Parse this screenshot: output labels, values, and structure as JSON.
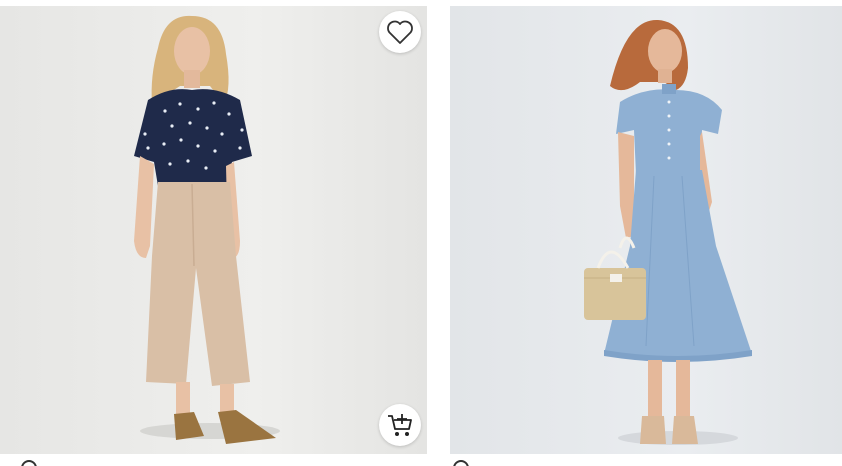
{
  "products": [
    {
      "image_alt": "",
      "favorite_icon": "heart-outline-icon",
      "cart_icon": "add-to-cart-icon",
      "colors": {
        "top": "#1f2a4a",
        "pants": "#d9bfa6",
        "shoes": "#9a7440",
        "hair": "#d8b47c",
        "skin": "#e8c1a5"
      }
    },
    {
      "image_alt": "",
      "colors": {
        "dress": "#8fb0d3",
        "hair": "#b86a3c",
        "bag": "#d8c49a",
        "skin": "#e5b89a",
        "shoes": "#d9b99a"
      }
    }
  ]
}
